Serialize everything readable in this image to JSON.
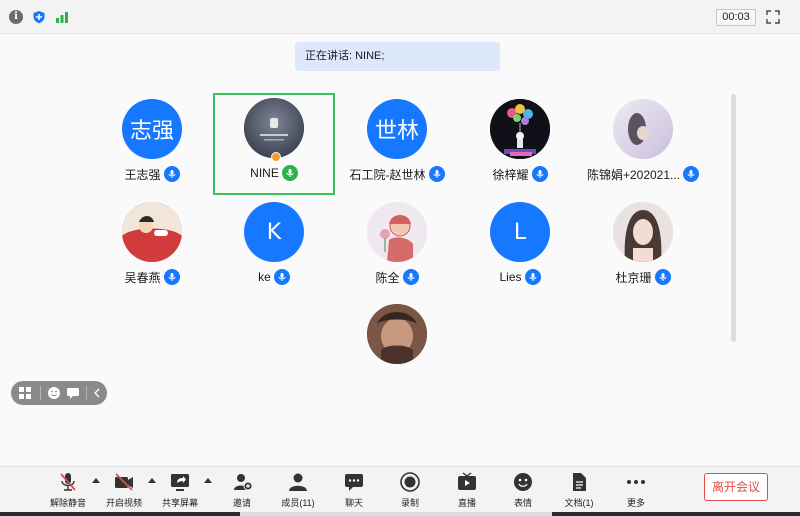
{
  "topbar": {
    "timer": "00:03"
  },
  "speaking_banner": "正在讲话: NINE;",
  "participants": [
    {
      "name": "王志强",
      "avatar_text": "志强",
      "avatar_type": "text",
      "mic": "blue"
    },
    {
      "name": "NINE",
      "avatar_text": "",
      "avatar_type": "photo-dark",
      "mic": "green",
      "active_speaker": true,
      "host": true
    },
    {
      "name": "石工院-赵世林",
      "avatar_text": "世林",
      "avatar_type": "text",
      "mic": "blue"
    },
    {
      "name": "徐梓耀",
      "avatar_text": "",
      "avatar_type": "photo-balloons",
      "mic": "blue"
    },
    {
      "name": "陈锦娟+202021...",
      "avatar_text": "",
      "avatar_type": "photo-pale",
      "mic": "blue"
    },
    {
      "name": "吴春燕",
      "avatar_text": "",
      "avatar_type": "photo-cartoon-red",
      "mic": "blue"
    },
    {
      "name": "ke",
      "avatar_text": "K",
      "avatar_type": "text",
      "mic": "blue"
    },
    {
      "name": "陈全",
      "avatar_text": "",
      "avatar_type": "photo-sketch",
      "mic": "blue"
    },
    {
      "name": "Lies",
      "avatar_text": "L",
      "avatar_type": "text",
      "mic": "blue"
    },
    {
      "name": "杜京珊",
      "avatar_text": "",
      "avatar_type": "photo-girl",
      "mic": "blue"
    },
    {
      "name": "",
      "avatar_text": "",
      "avatar_type": "photo-brown",
      "mic": "none"
    }
  ],
  "toolbar": {
    "unmute": "解除静音",
    "start_video": "开启视频",
    "share_screen": "共享屏幕",
    "invite": "邀请",
    "members": "成员(11)",
    "chat": "聊天",
    "record": "录制",
    "live": "直播",
    "reactions": "表情",
    "docs": "文档(1)",
    "more": "更多",
    "leave": "离开会议"
  },
  "colors": {
    "accent": "#1677ff",
    "active_border": "#3cc05a",
    "leave": "#e34a4a",
    "banner_bg": "#dde9fb"
  }
}
